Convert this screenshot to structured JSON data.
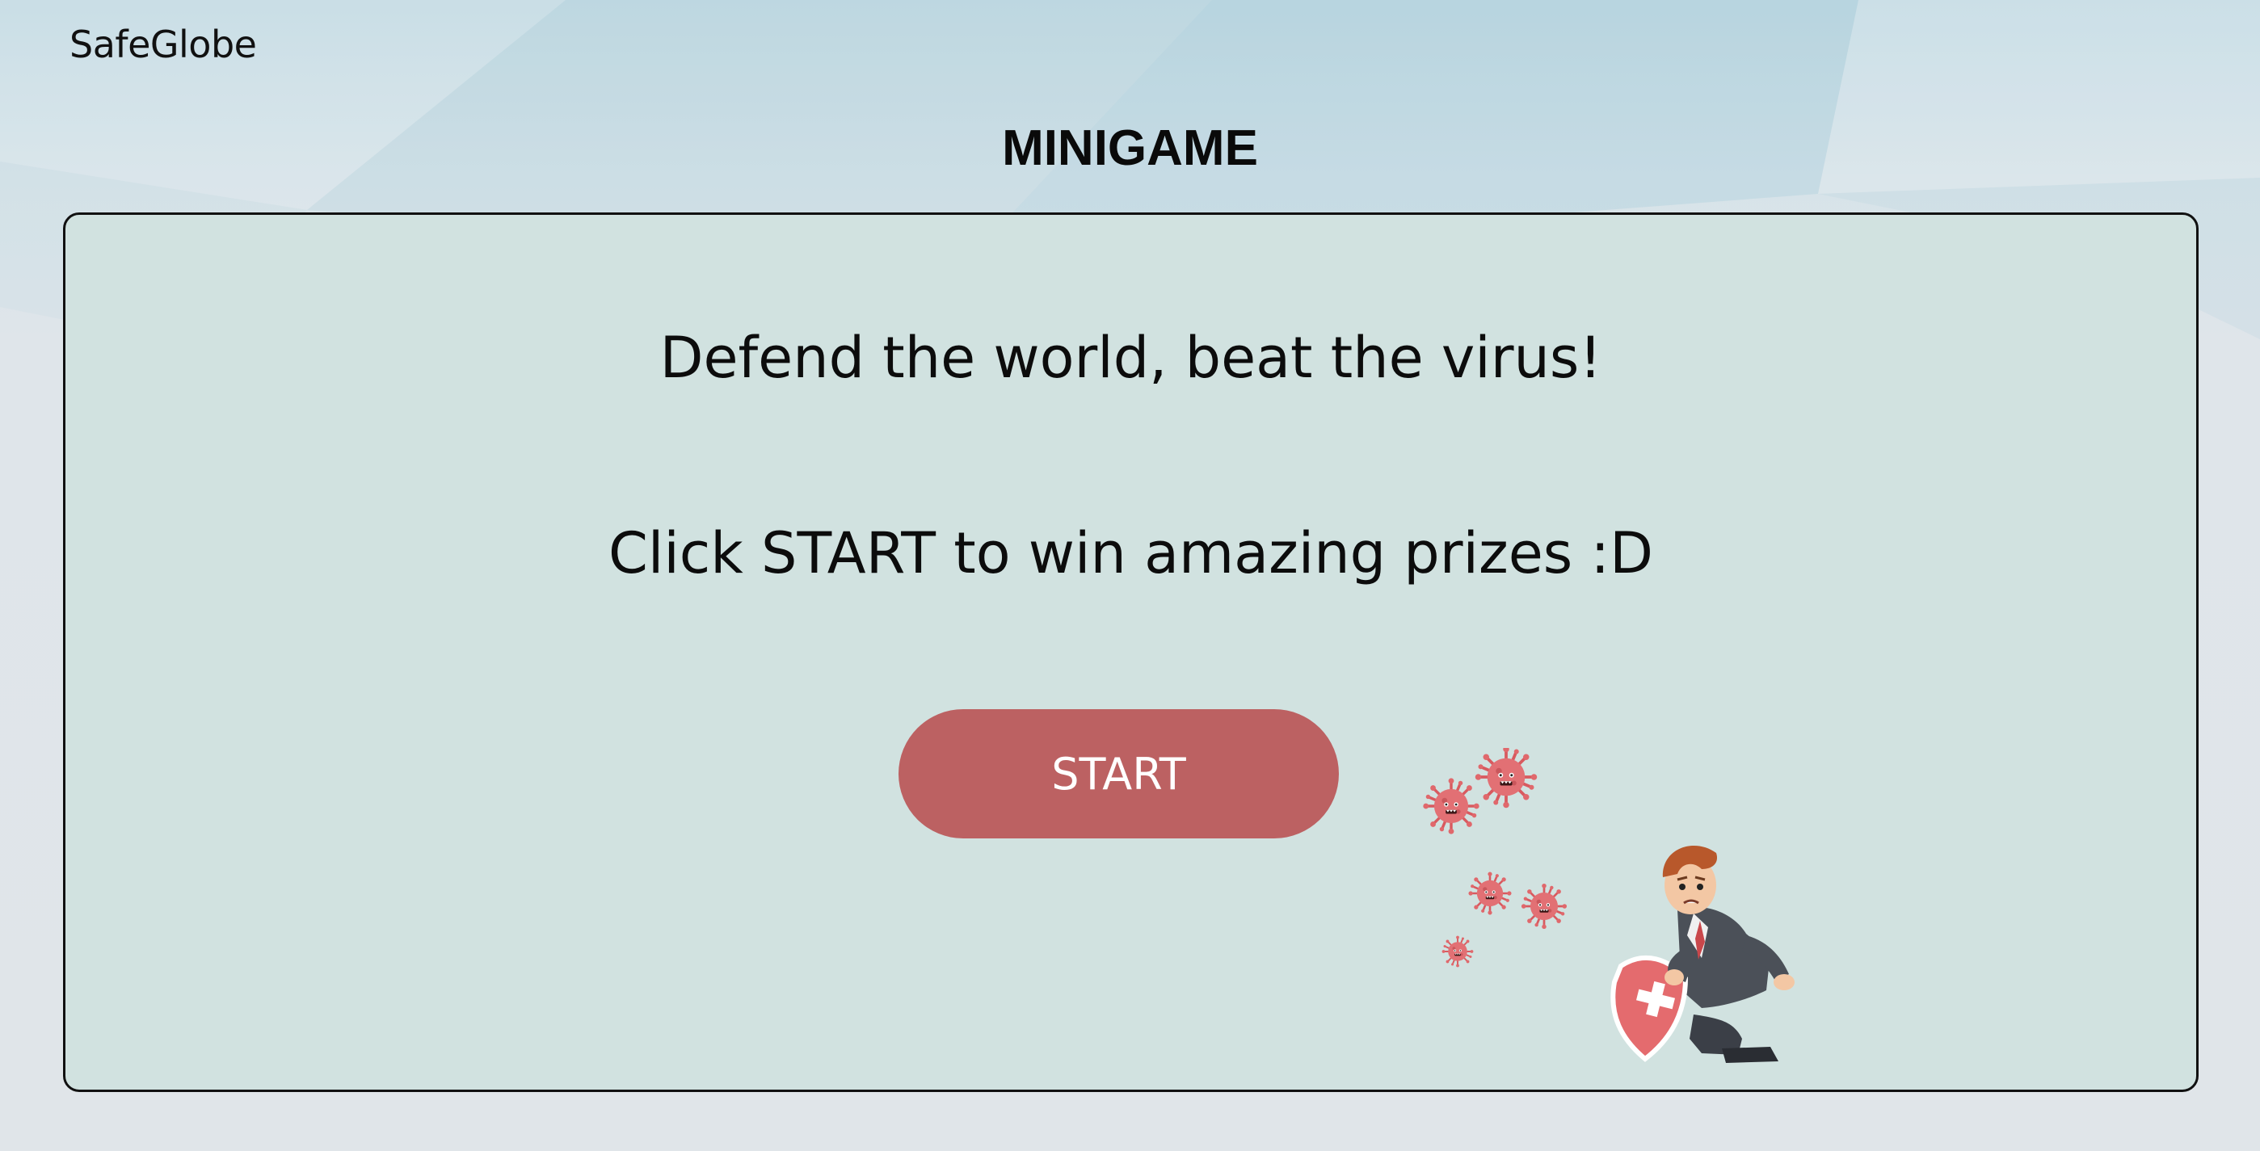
{
  "brand": {
    "name": "SafeGlobe"
  },
  "page": {
    "title": "MINIGAME"
  },
  "game": {
    "headline": "Defend the world, beat the virus!",
    "instruction": "Click START to win amazing prizes :D",
    "start_label": "START",
    "illustration_icon": "man-with-shield-fighting-viruses"
  },
  "colors": {
    "panel_background": "#d1e2e0",
    "button_background": "#bc6162",
    "virus": "#e0686c",
    "shield": "#e46b6e"
  }
}
